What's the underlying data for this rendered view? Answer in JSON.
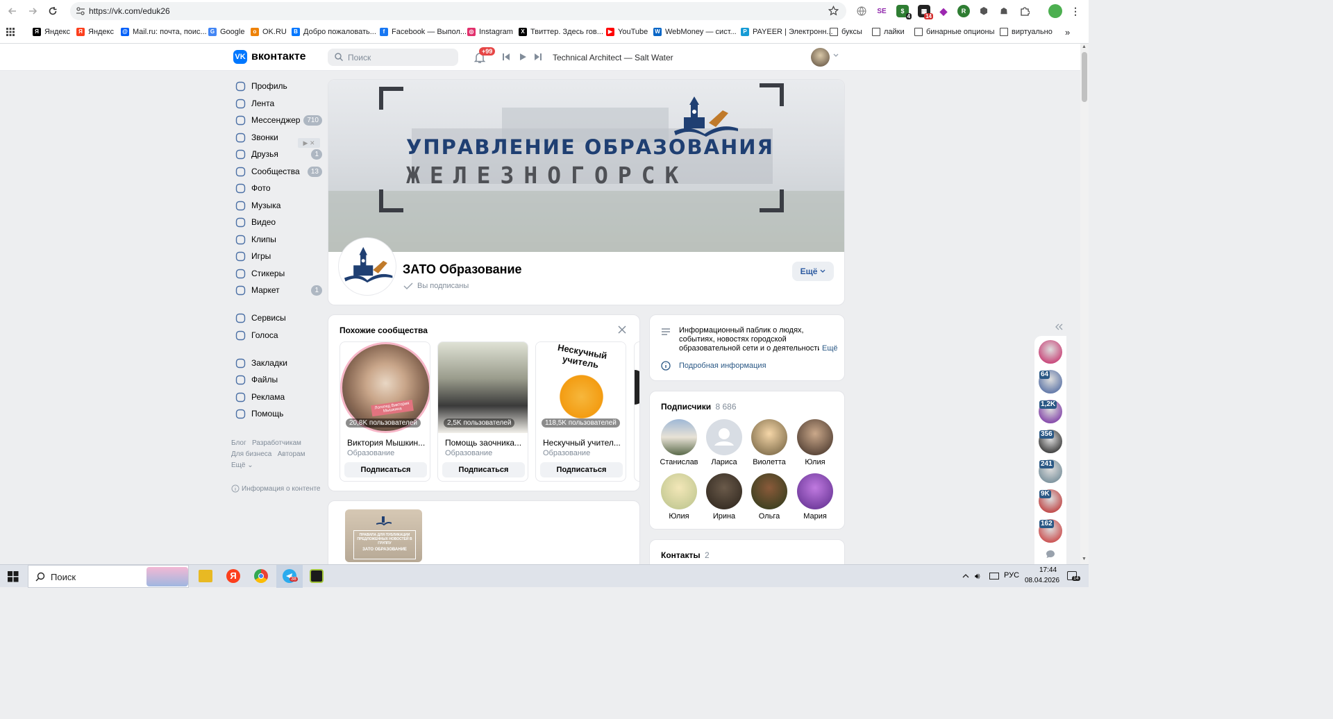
{
  "browser": {
    "url": "https://vk.com/eduk26",
    "ext_badges": {
      "b1": "4",
      "b2": "14"
    },
    "bookmarks": [
      {
        "label": "Яндекс",
        "color": "#000000",
        "glyph": "Я"
      },
      {
        "label": "Яндекс",
        "color": "#fc3f1d",
        "glyph": "Я"
      },
      {
        "label": "Mail.ru: почта, поис...",
        "color": "#005ff9",
        "glyph": "@"
      },
      {
        "label": "Google",
        "color": "#4285f4",
        "glyph": "G"
      },
      {
        "label": "OK.RU",
        "color": "#ee8208",
        "glyph": "o"
      },
      {
        "label": "Добро пожаловать...",
        "color": "#0077ff",
        "glyph": "B"
      },
      {
        "label": "Facebook — Выпол...",
        "color": "#1877f2",
        "glyph": "f"
      },
      {
        "label": "Instagram",
        "color": "#e1306c",
        "glyph": "◎"
      },
      {
        "label": "Твиттер. Здесь гов...",
        "color": "#000000",
        "glyph": "X"
      },
      {
        "label": "YouTube",
        "color": "#ff0000",
        "glyph": "▶"
      },
      {
        "label": "WebMoney — сист...",
        "color": "#0866c6",
        "glyph": "W"
      },
      {
        "label": "PAYEER | Электронн...",
        "color": "#169bd5",
        "glyph": "P"
      },
      {
        "label": "буксы",
        "color": "folder",
        "glyph": ""
      },
      {
        "label": "лайки",
        "color": "folder",
        "glyph": ""
      },
      {
        "label": "бинарные опционы",
        "color": "folder",
        "glyph": ""
      },
      {
        "label": "виртуально",
        "color": "folder",
        "glyph": ""
      }
    ]
  },
  "vk": {
    "logo_text": "вконтакте",
    "search_placeholder": "Поиск",
    "notif_badge": "+99",
    "player_track": "Technical Architect — Salt Water",
    "nav": [
      {
        "label": "Профиль",
        "icon": "profile-icon",
        "count": ""
      },
      {
        "label": "Лента",
        "icon": "feed-icon",
        "count": ""
      },
      {
        "label": "Мессенджер",
        "icon": "messenger-icon",
        "count": "710"
      },
      {
        "label": "Звонки",
        "icon": "phone-icon",
        "count": ""
      },
      {
        "label": "Друзья",
        "icon": "friends-icon",
        "count": "1"
      },
      {
        "label": "Сообщества",
        "icon": "communities-icon",
        "count": "13"
      },
      {
        "label": "Фото",
        "icon": "photo-icon",
        "count": ""
      },
      {
        "label": "Музыка",
        "icon": "music-icon",
        "count": ""
      },
      {
        "label": "Видео",
        "icon": "video-icon",
        "count": ""
      },
      {
        "label": "Клипы",
        "icon": "clips-icon",
        "count": ""
      },
      {
        "label": "Игры",
        "icon": "games-icon",
        "count": ""
      },
      {
        "label": "Стикеры",
        "icon": "stickers-icon",
        "count": ""
      },
      {
        "label": "Маркет",
        "icon": "market-icon",
        "count": "1"
      },
      {
        "label": "Сервисы",
        "icon": "services-icon",
        "count": ""
      },
      {
        "label": "Голоса",
        "icon": "votes-icon",
        "count": ""
      },
      {
        "label": "Закладки",
        "icon": "bookmark-icon",
        "count": ""
      },
      {
        "label": "Файлы",
        "icon": "files-icon",
        "count": ""
      },
      {
        "label": "Реклама",
        "icon": "ads-icon",
        "count": ""
      },
      {
        "label": "Помощь",
        "icon": "help-icon",
        "count": ""
      }
    ],
    "footer_links": [
      "Блог",
      "Разработчикам",
      "Для бизнеса",
      "Авторам",
      "Ещё"
    ],
    "content_info": "Информация о контенте",
    "cover": {
      "line1": "УПРАВЛЕНИЕ ОБРАЗОВАНИЯ",
      "line2": "ЖЕЛЕЗНОГОРСК"
    },
    "group": {
      "name": "ЗАТО Образование",
      "status": "Вы подписаны",
      "more_button": "Ещё"
    },
    "similar": {
      "title": "Похожие сообщества",
      "items": [
        {
          "name": "Виктория Мышкин...",
          "category": "Образование",
          "members": "20,8K пользователей",
          "button": "Подписаться",
          "photo_caption": "Логопед Виктория Мышкина"
        },
        {
          "name": "Помощь заочника...",
          "category": "Образование",
          "members": "2,5K пользователей",
          "button": "Подписаться"
        },
        {
          "name": "Нескучный учител...",
          "category": "Образование",
          "members": "118,5K пользователей",
          "button": "Подписаться",
          "photo_caption": "Нескучный учитель"
        }
      ]
    },
    "post_thumb_text": "ПРАВИЛА ДЛЯ ПУБЛИКАЦИИ ПРЕДЛОЖЕННЫХ НОВОСТЕЙ В ГРУППУ",
    "post_thumb_sub": "ЗАТО ОБРАЗОВАНИЕ",
    "about": {
      "text": "Информационный паблик о людях, событиях, новостях городской образовательной сети и о деятельности",
      "more": "Ещё",
      "details": "Подробная информация"
    },
    "subscribers": {
      "title": "Подписчики",
      "count": "8 686",
      "people": [
        "Станислав",
        "Лариса",
        "Виолетта",
        "Юлия",
        "Юлия",
        "Ирина",
        "Ольга",
        "Мария"
      ]
    },
    "contacts": {
      "title": "Контакты",
      "count": "2"
    },
    "right_strip_badges": [
      "64",
      "1,2K",
      "356",
      "241",
      "9K",
      "162"
    ]
  },
  "taskbar": {
    "search_placeholder": "Поиск",
    "tg_badge": "38",
    "lang": "РУС",
    "time": "17:44",
    "date": "08.04.2026",
    "notif_count": "14"
  }
}
